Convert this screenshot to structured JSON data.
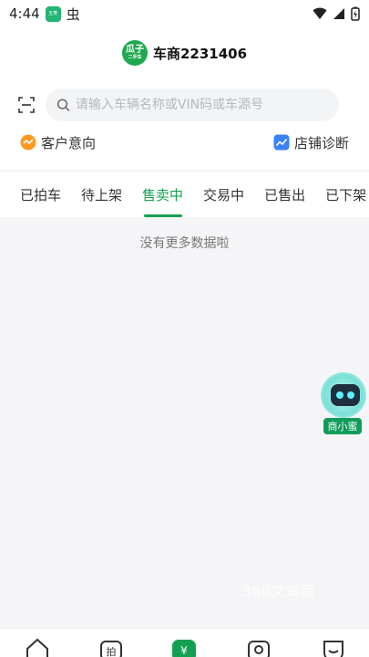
{
  "status_bar": {
    "time": "4:44",
    "app_badge": "五菱",
    "debug_glyph": "虫",
    "icons": [
      "wifi-icon",
      "signal-icon",
      "battery-icon"
    ]
  },
  "header": {
    "logo_text": "瓜子",
    "logo_sub": "二手车",
    "dealer_name": "车商2231406"
  },
  "search": {
    "placeholder": "请输入车辆名称或VIN码或车源号",
    "value": ""
  },
  "quick_links": {
    "customer_intent": "客户意向",
    "store_diagnosis": "店铺诊断"
  },
  "tabs": [
    {
      "label": "已拍车",
      "active": false
    },
    {
      "label": "待上架",
      "active": false
    },
    {
      "label": "售卖中",
      "active": true
    },
    {
      "label": "交易中",
      "active": false
    },
    {
      "label": "已售出",
      "active": false
    },
    {
      "label": "已下架",
      "active": false
    }
  ],
  "empty_message": "没有更多数据啦",
  "assistant": {
    "label": "商小蜜"
  },
  "watermark": "380文章圈",
  "colors": {
    "accent": "#14a052",
    "assistant_badge": "#0f9b5a"
  }
}
